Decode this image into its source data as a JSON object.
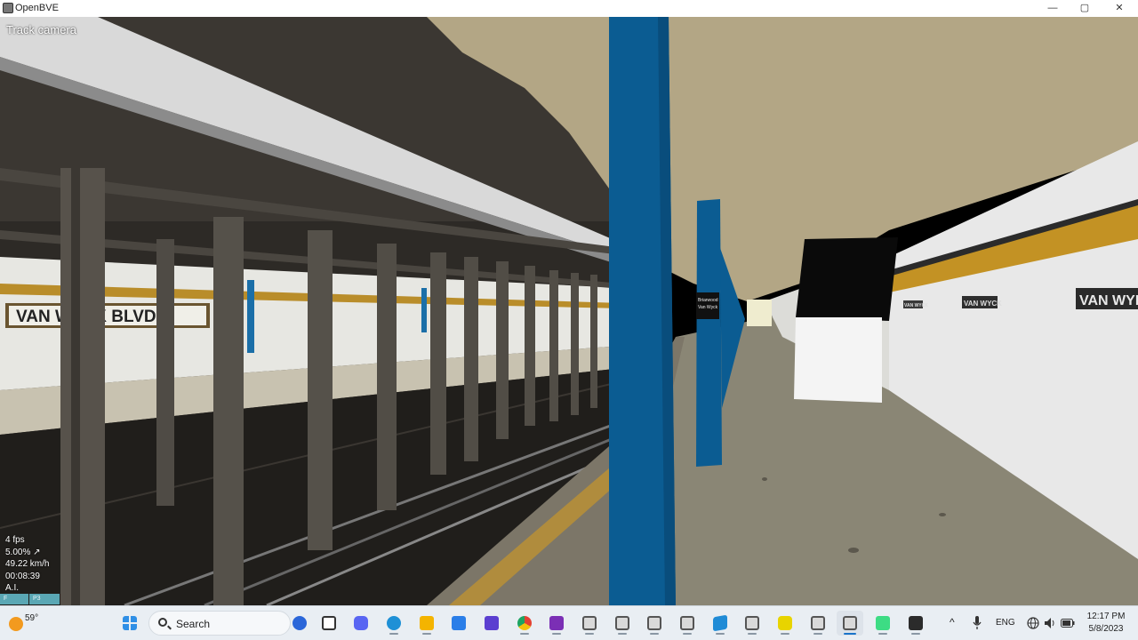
{
  "window": {
    "title": "OpenBVE",
    "minimize_symbol": "—",
    "maximize_symbol": "▢",
    "close_symbol": "✕"
  },
  "scene": {
    "camera_mode": "Track camera",
    "stats": {
      "fps": "4 fps",
      "throttle": "5.00% ↗",
      "speed": "49.22 km/h",
      "time": "00:08:39",
      "mode": "A.I."
    },
    "signs": {
      "left_wall": "VAN WYCK BLVD",
      "right_wall_large": "VAN WYK",
      "right_wall_small_1": "VAN WYCK",
      "right_wall_small_2": "VAN WYCK",
      "column_sign_line1": "Briarwood",
      "column_sign_line2": "Van Wyck"
    },
    "hud_tabs": [
      "F",
      "P3"
    ],
    "colors": {
      "column_blue": "#0b5c92",
      "wall_stripe_yellow": "#c99522",
      "ceiling": "#b2a584",
      "platform": "#8c8877"
    }
  },
  "taskbar": {
    "weather": {
      "temp": "59°",
      "icon": "sun-icon"
    },
    "search": {
      "label": "Search"
    },
    "apps": [
      {
        "name": "start",
        "icon": "windows-start-icon",
        "color": "#2f8fe6"
      },
      {
        "name": "bing",
        "icon": "bing-chat-icon",
        "color": "#2a66d9"
      },
      {
        "name": "task-view",
        "icon": "task-view-icon",
        "color": "#333333"
      },
      {
        "name": "discord",
        "icon": "discord-icon",
        "color": "#5865f2"
      },
      {
        "name": "edge",
        "icon": "edge-icon",
        "color": "#1e90d6"
      },
      {
        "name": "files",
        "icon": "folder-icon",
        "color": "#f4b400"
      },
      {
        "name": "store",
        "icon": "store-icon",
        "color": "#2a7ee8"
      },
      {
        "name": "visual-studio",
        "icon": "visual-studio-icon",
        "color": "#5b3fd0"
      },
      {
        "name": "chrome",
        "icon": "chrome-icon",
        "color": "#e34133"
      },
      {
        "name": "onenote",
        "icon": "onenote-icon",
        "color": "#7b2fb5"
      },
      {
        "name": "openbve-1",
        "icon": "openbve-icon",
        "color": "#555555"
      },
      {
        "name": "openbve-2",
        "icon": "openbve-icon",
        "color": "#555555"
      },
      {
        "name": "openbve-3",
        "icon": "openbve-icon",
        "color": "#555555"
      },
      {
        "name": "openbve-4",
        "icon": "openbve-icon",
        "color": "#555555"
      },
      {
        "name": "windows-app",
        "icon": "blue-app-icon",
        "color": "#1f8bd6"
      },
      {
        "name": "openbve-5",
        "icon": "openbve-icon",
        "color": "#555555"
      },
      {
        "name": "notes",
        "icon": "sticky-note-icon",
        "color": "#e8d400"
      },
      {
        "name": "openbve-6",
        "icon": "openbve-icon",
        "color": "#555555"
      },
      {
        "name": "openbve-active",
        "icon": "openbve-icon",
        "color": "#555555"
      },
      {
        "name": "android-studio",
        "icon": "android-icon",
        "color": "#3ddc84"
      },
      {
        "name": "terminal",
        "icon": "terminal-icon",
        "color": "#2b2b2b"
      }
    ],
    "tray": {
      "chevron": "^",
      "language": "ENG",
      "time": "12:17 PM",
      "date": "5/8/2023"
    }
  }
}
